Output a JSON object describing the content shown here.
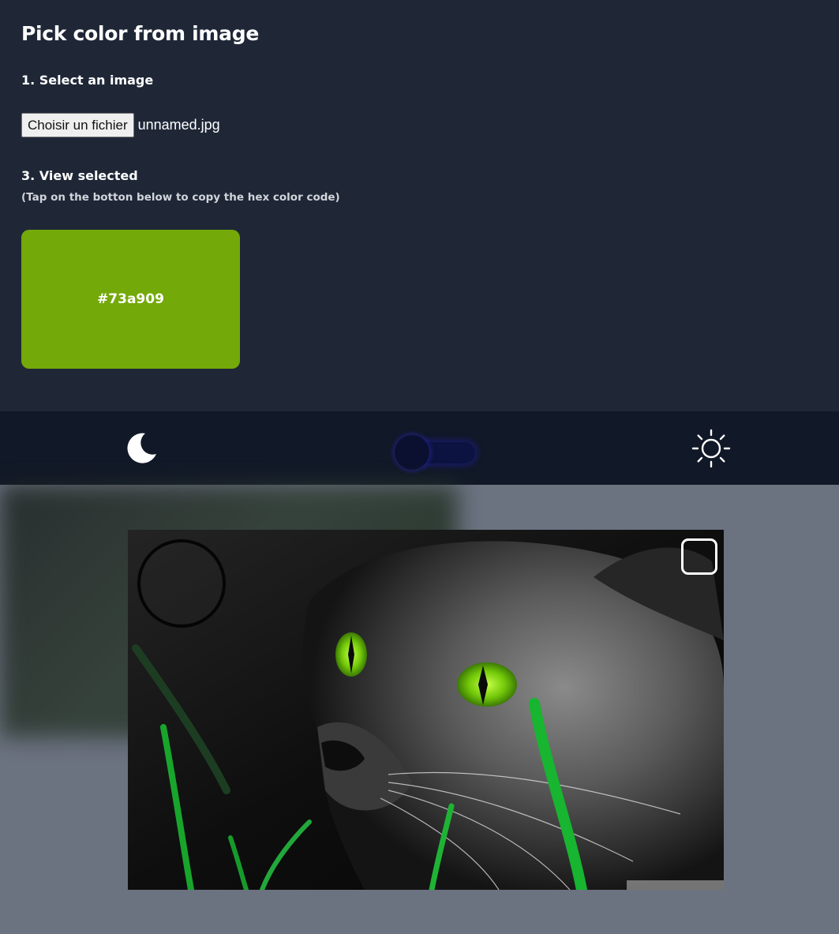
{
  "title": "Pick color from image",
  "step1": {
    "label": "1. Select an image"
  },
  "file_input": {
    "button_label": "Choisir un fichier",
    "file_name": "unnamed.jpg"
  },
  "step3": {
    "label": "3. View selected",
    "hint": "(Tap on the botton below to copy the hex color code)"
  },
  "selected_color": {
    "hex": "#73a909"
  },
  "theme_toggle": {
    "left_icon": "moon-icon",
    "right_icon": "sun-icon",
    "state": "dark"
  },
  "image_view": {
    "tool_icons": [
      "magnifier-lens",
      "expand-icon"
    ]
  },
  "colors": {
    "panel_bg": "#1f2737",
    "toggle_bar_bg": "#111827",
    "page_bg": "#6b7280",
    "cat_eye_green": "#73a909"
  }
}
